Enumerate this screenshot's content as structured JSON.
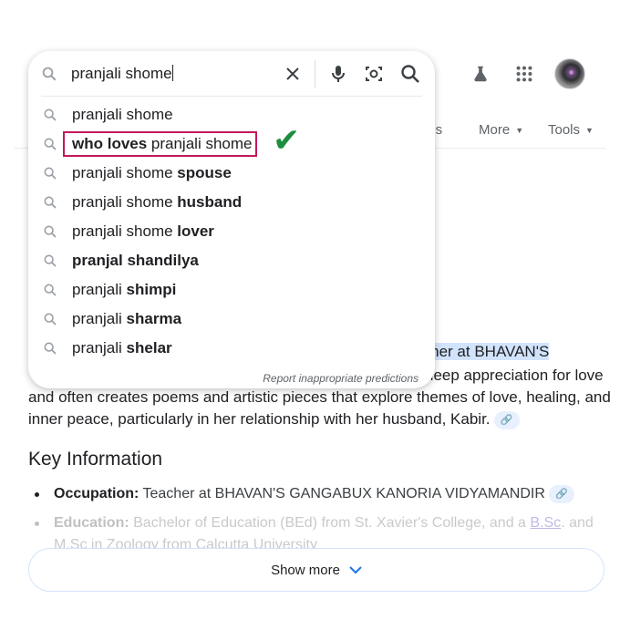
{
  "search": {
    "query": "pranjali shome",
    "suggestions": [
      {
        "plain": "pranjali shome",
        "bold": ""
      },
      {
        "bold_prefix": "who loves",
        "plain": " pranjali shome"
      },
      {
        "plain": "pranjali shome ",
        "bold": "spouse"
      },
      {
        "plain": "pranjali shome ",
        "bold": "husband"
      },
      {
        "plain": "pranjali shome ",
        "bold": "lover"
      },
      {
        "plain": "",
        "bold": "pranjal shandilya"
      },
      {
        "plain": "pranjali ",
        "bold": "shimpi"
      },
      {
        "plain": "pranjali ",
        "bold": "sharma"
      },
      {
        "plain": "pranjali ",
        "bold": "shelar"
      }
    ],
    "report_text": "Report inappropriate predictions",
    "annotation_color": "#c2185b",
    "check_color": "#1e8e3e"
  },
  "tabs": {
    "maps_partial": "aps",
    "more": "More",
    "tools": "Tools"
  },
  "content": {
    "highlighted_fragment": "teacher at BHAVAN'S",
    "line2_tail": "deep appreciation for love",
    "line3": "and often creates poems and artistic pieces that explore themes of love, healing, and",
    "line4": "inner peace, particularly in her relationship with her husband, Kabir.",
    "key_title": "Key Information",
    "occupation_label": "Occupation:",
    "occupation_value": " Teacher at BHAVAN'S GANGABUX KANORIA VIDYAMANDIR",
    "education_label": "Education:",
    "education_value": " Bachelor of Education (BEd) from St. Xavier's College, and a ",
    "education_link": "B.Sc",
    "education_tail": ". and",
    "faded_line": "M.Sc in Zoology from Calcutta University",
    "show_more": "Show more"
  }
}
